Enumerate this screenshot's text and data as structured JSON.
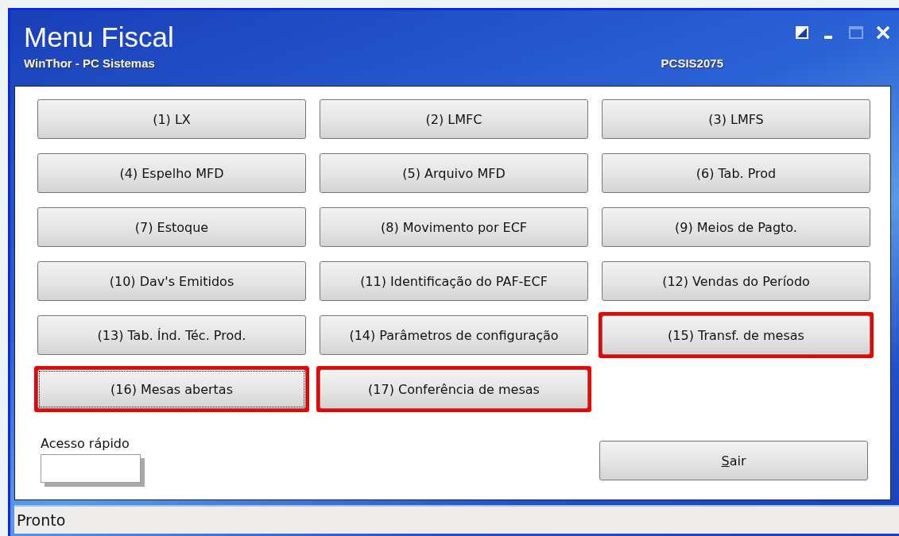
{
  "window": {
    "title": "Menu Fiscal",
    "subtitle": "WinThor - PC Sistemas",
    "code": "PCSIS2075"
  },
  "title_buttons": [
    {
      "kind": "restore",
      "disabled": false
    },
    {
      "kind": "minimize",
      "disabled": false
    },
    {
      "kind": "maximize",
      "disabled": true
    },
    {
      "kind": "close",
      "disabled": false
    }
  ],
  "menu_buttons": [
    {
      "label": "(1) LX",
      "highlighted": false,
      "focused": false
    },
    {
      "label": "(2) LMFC",
      "highlighted": false,
      "focused": false
    },
    {
      "label": "(3) LMFS",
      "highlighted": false,
      "focused": false
    },
    {
      "label": "(4) Espelho  MFD",
      "highlighted": false,
      "focused": false
    },
    {
      "label": "(5) Arquivo MFD",
      "highlighted": false,
      "focused": false
    },
    {
      "label": "(6) Tab. Prod",
      "highlighted": false,
      "focused": false
    },
    {
      "label": "(7) Estoque",
      "highlighted": false,
      "focused": false
    },
    {
      "label": "(8) Movimento por ECF",
      "highlighted": false,
      "focused": false
    },
    {
      "label": "(9) Meios de Pagto.",
      "highlighted": false,
      "focused": false
    },
    {
      "label": "(10) Dav's Emitidos",
      "highlighted": false,
      "focused": false
    },
    {
      "label": "(11) Identificação do PAF-ECF",
      "highlighted": false,
      "focused": false
    },
    {
      "label": "(12) Vendas do Período",
      "highlighted": false,
      "focused": false
    },
    {
      "label": "(13) Tab. Índ. Téc. Prod.",
      "highlighted": false,
      "focused": false
    },
    {
      "label": "(14) Parâmetros de configuração",
      "highlighted": false,
      "focused": false
    },
    {
      "label": "(15) Transf. de mesas",
      "highlighted": true,
      "focused": false
    },
    {
      "label": "(16) Mesas abertas",
      "highlighted": true,
      "focused": true
    },
    {
      "label": "(17) Conferência de mesas",
      "highlighted": true,
      "focused": false
    }
  ],
  "quick_access": {
    "label": "Acesso rápido"
  },
  "exit_button": {
    "label_parts": [
      {
        "text": "S",
        "underlined": true
      },
      {
        "text": "air",
        "underlined": false
      }
    ]
  },
  "status_bar": {
    "text": "Pronto"
  }
}
